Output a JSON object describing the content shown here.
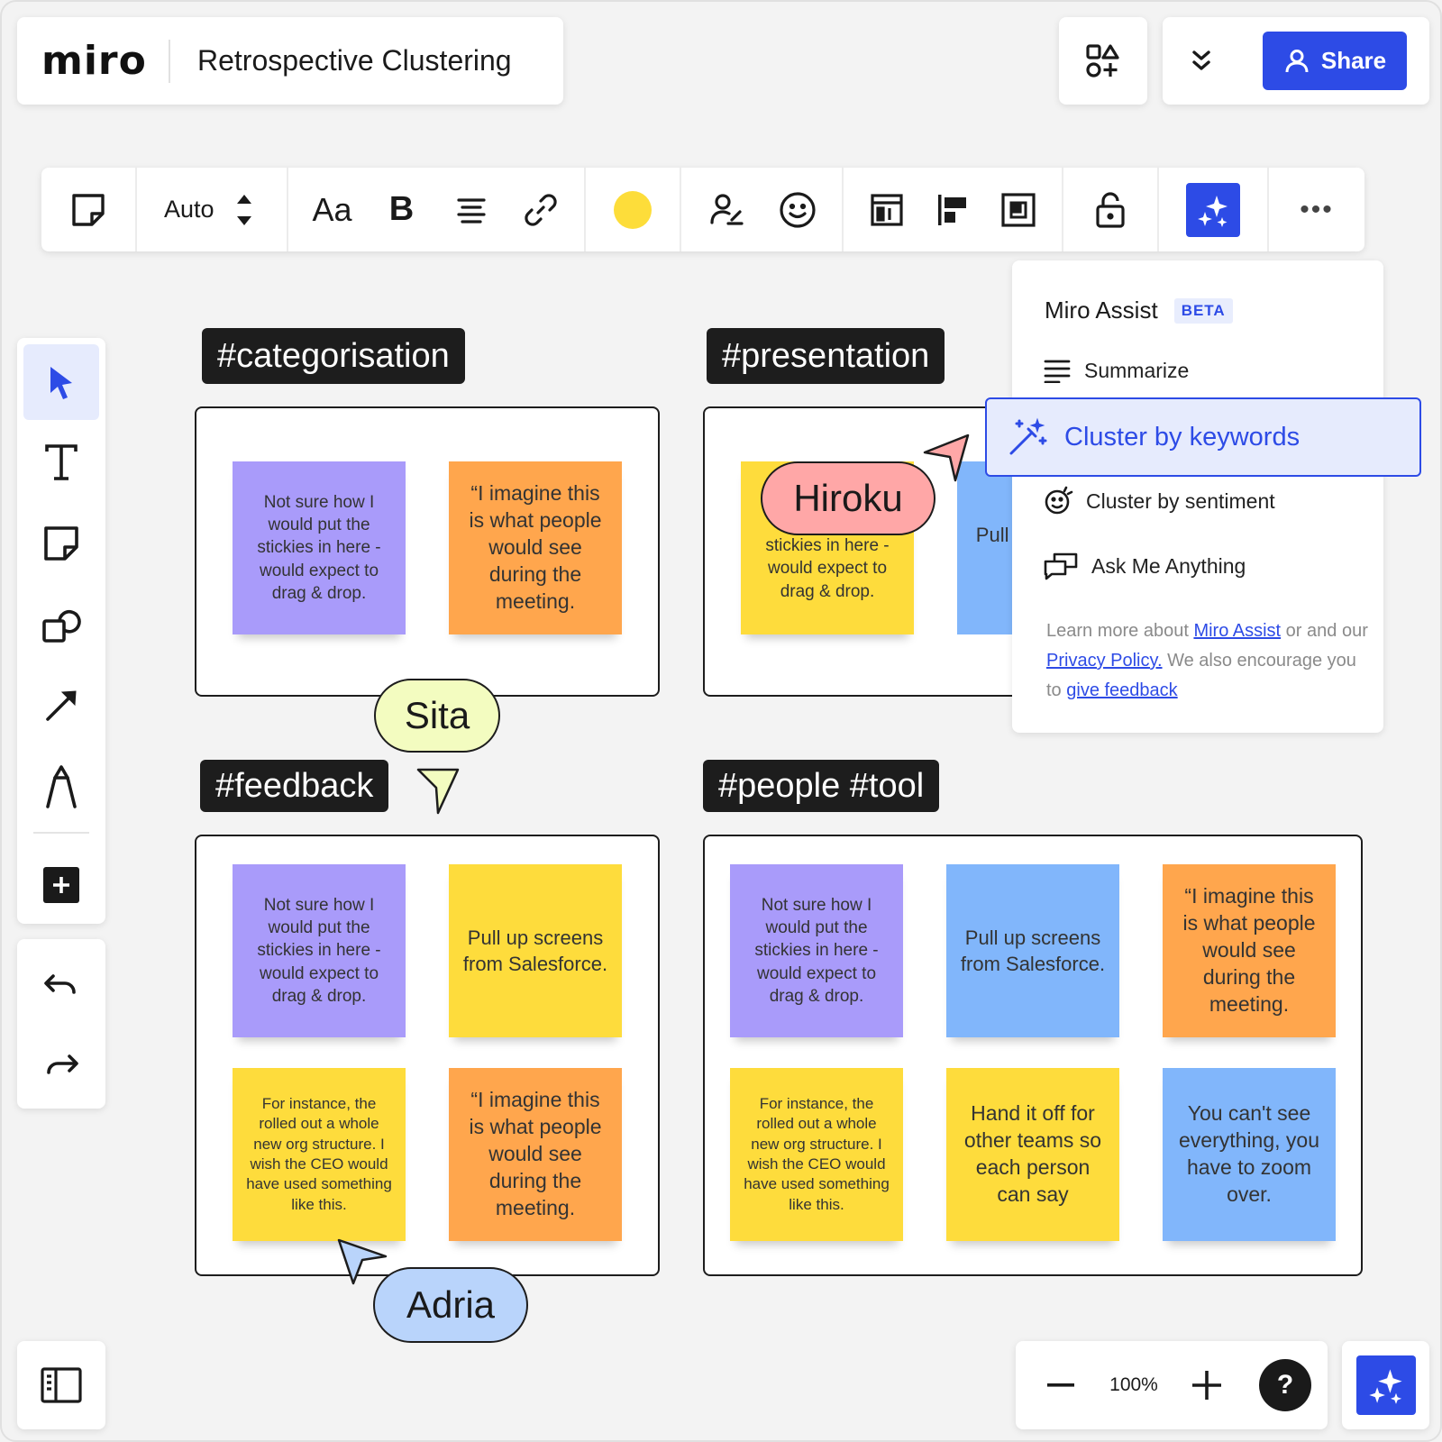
{
  "app": {
    "logo": "miro",
    "board_title": "Retrospective Clustering",
    "share_label": "Share"
  },
  "toolbar": {
    "size_label": "Auto",
    "text_style_label": "Aa",
    "bold_label": "B",
    "color": "#fddd3a",
    "more_label": "•••"
  },
  "tags": {
    "categorisation": "#categorisation",
    "presentation": "#presentation",
    "feedback": "#feedback",
    "people_tool": "#people #tool"
  },
  "frames": {
    "categorisation": [
      {
        "text": "Not sure how I would put the stickies in here - would expect to drag & drop.",
        "color": "#a99bfa"
      },
      {
        "text": "“I imagine this is what people would see during the meeting.",
        "color": "#ffa64d"
      }
    ],
    "presentation": [
      {
        "text": "stickies in here - would expect to drag & drop.",
        "color": "#fedc3c"
      },
      {
        "text": "Pull up screens from",
        "color": "#81b6fb"
      }
    ],
    "feedback": [
      {
        "text": "Not sure how I would put the stickies in here - would expect to drag & drop.",
        "color": "#a99bfa"
      },
      {
        "text": "Pull up screens from Salesforce.",
        "color": "#fedc3c"
      },
      {
        "text": "For instance, the rolled out a whole new org structure. I wish the CEO would have used something like this.",
        "color": "#fedc3c"
      },
      {
        "text": "“I imagine this is what people would see during the meeting.",
        "color": "#ffa64d"
      }
    ],
    "people_tool": [
      {
        "text": "Not sure how I would put the stickies in here - would expect to drag & drop.",
        "color": "#a99bfa"
      },
      {
        "text": "Pull up screens from Salesforce.",
        "color": "#81b6fb"
      },
      {
        "text": "“I imagine this is what people would see during the meeting.",
        "color": "#ffa64d"
      },
      {
        "text": "For instance, the rolled out a whole new org structure. I wish the CEO would have used something like this.",
        "color": "#fedc3c"
      },
      {
        "text": "Hand it off for other teams so each person can say",
        "color": "#fedc3c"
      },
      {
        "text": "You can't see everything, you have to zoom over.",
        "color": "#81b6fb"
      }
    ]
  },
  "cursors": {
    "hiroku": "Hiroku",
    "sita": "Sita",
    "adria": "Adria"
  },
  "assist": {
    "title": "Miro Assist",
    "badge": "BETA",
    "summarize": "Summarize",
    "cluster_keywords": "Cluster by keywords",
    "cluster_sentiment": "Cluster by sentiment",
    "ask": "Ask Me Anything",
    "foot_1": "Learn more about ",
    "foot_link_1": "Miro Assist",
    "foot_2": " or and our ",
    "foot_link_2": "Privacy Policy.",
    "foot_3": " We also encourage you to ",
    "foot_link_3": "give feedback"
  },
  "zoom": {
    "level": "100%",
    "help": "?"
  },
  "colors": {
    "accent": "#2d4be6",
    "purple": "#a99bfa",
    "orange": "#ffa64d",
    "yellow": "#fedc3c",
    "blue": "#81b6fb"
  }
}
